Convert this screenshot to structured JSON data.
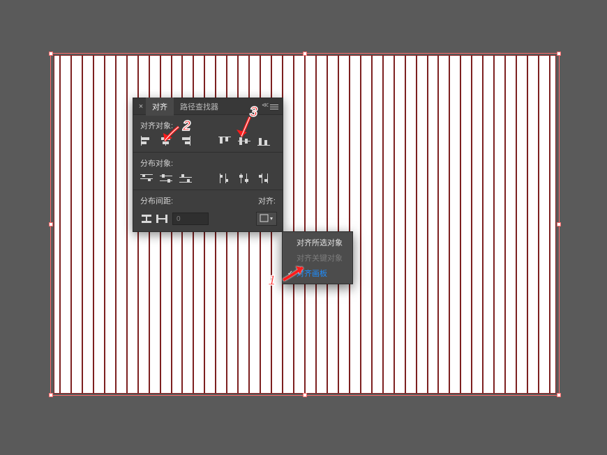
{
  "tabs": {
    "align": "对齐",
    "pathfinder": "路径查找器"
  },
  "sections": {
    "align_objects": "对齐对象:",
    "distribute_objects": "分布对象:",
    "distribute_spacing": "分布间距:",
    "align_to": "对齐:"
  },
  "spacing_value": "0",
  "popup": {
    "selection": "对齐所选对象",
    "key_object": "对齐关键对象",
    "artboard": "对齐画板"
  },
  "annotations": {
    "one": "1",
    "two": "2",
    "three": "3"
  },
  "stripe_count": 45
}
